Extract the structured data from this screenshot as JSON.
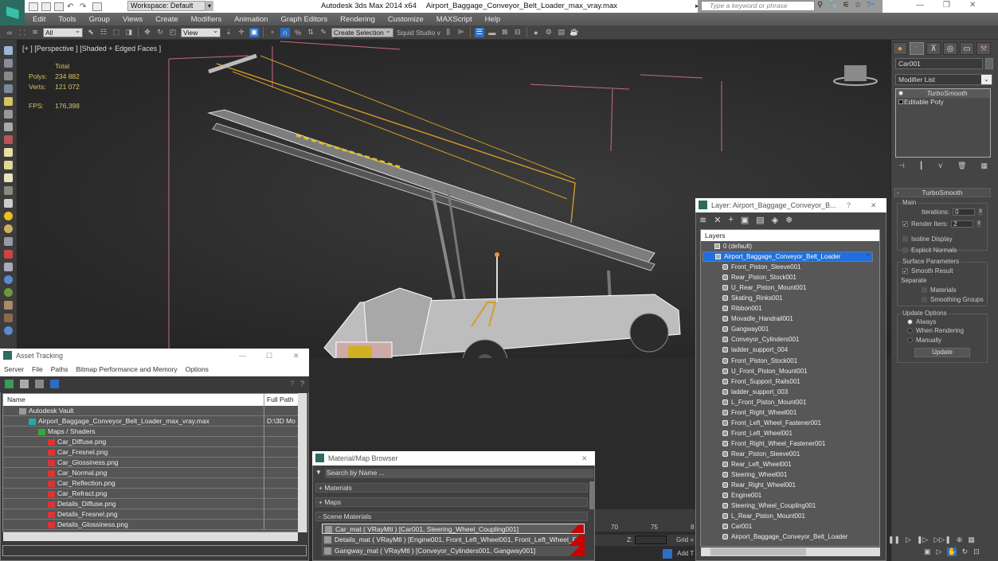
{
  "titlebar": {
    "workspace": "Workspace: Default",
    "app": "Autodesk 3ds Max  2014 x64",
    "file": "Airport_Baggage_Conveyor_Belt_Loader_max_vray.max",
    "search_placeholder": "Type a keyword or phrase"
  },
  "menu": [
    "Edit",
    "Tools",
    "Group",
    "Views",
    "Create",
    "Modifiers",
    "Animation",
    "Graph Editors",
    "Rendering",
    "Customize",
    "MAXScript",
    "Help"
  ],
  "toolbar": {
    "selection_filter": "All",
    "reference_coord": "View",
    "named_selection": "Create Selection Se",
    "squid_studio": "Squid Studio v"
  },
  "viewport": {
    "label": "[+ ] [Perspective ] [Shaded + Edged Faces ]",
    "stats": {
      "header": "Total",
      "polys_label": "Polys:",
      "polys": "234 882",
      "verts_label": "Verts:",
      "verts": "121 072",
      "fps_label": "FPS:",
      "fps": "176,398"
    }
  },
  "command_panel": {
    "object_name": "Car001",
    "modifier_list": "Modifier List",
    "stack": [
      "TurboSmooth",
      "Editable Poly"
    ],
    "rollout_title": "TurboSmooth",
    "main_group": "Main",
    "iterations_label": "Iterations:",
    "iterations": "0",
    "render_iters_label": "Render Iters:",
    "render_iters": "2",
    "render_iters_checked": true,
    "isoline_display": "Isoline Display",
    "explicit_normals": "Explicit Normals",
    "surface_group": "Surface Parameters",
    "smooth_result": "Smooth Result",
    "smooth_result_checked": true,
    "separate_label": "Separate",
    "materials": "Materials",
    "smoothing_groups": "Smoothing Groups",
    "update_group": "Update Options",
    "update_options": [
      "Always",
      "When Rendering",
      "Manually"
    ],
    "update_selected": "Always",
    "update_button": "Update"
  },
  "layer_dialog": {
    "title": "Layer: Airport_Baggage_Conveyor_B...",
    "help": "?",
    "close": "✕",
    "header": "Layers",
    "default_layer": "0 (default)",
    "selected_layer": "Airport_Baggage_Conveyor_Belt_Loader",
    "objects": [
      "Front_Piston_Sleeve001",
      "Rear_Piston_Stock001",
      "U_Rear_Piston_Mount001",
      "Skating_Rinks001",
      "Ribbon001",
      "Movadle_Handrail001",
      "Gangway001",
      "Conveyor_Cylinders001",
      "ladder_support_004",
      "Front_Piston_Stock001",
      "U_Front_Piston_Mount001",
      "Front_Support_Rails001",
      "ladder_support_003",
      "L_Front_Piston_Mount001",
      "Front_Right_Wheel001",
      "Front_Left_Wheel_Fastener001",
      "Front_Left_Wheel001",
      "Front_Right_Wheel_Fastener001",
      "Rear_Piston_Sleeve001",
      "Rear_Left_Wheel001",
      "Steering_Wheel001",
      "Rear_Right_Wheel001",
      "Engine001",
      "Steering_Wheel_Coupling001",
      "L_Rear_Piston_Mount001",
      "Car001",
      "Airport_Baggage_Conveyor_Belt_Loader"
    ]
  },
  "asset_tracking": {
    "title": "Asset Tracking",
    "menu": [
      "Server",
      "File",
      "Paths",
      "Bitmap Performance and Memory",
      "Options"
    ],
    "columns": [
      "Name",
      "Full Path"
    ],
    "rows": [
      {
        "name": "Autodesk Vault",
        "path": "",
        "level": 1
      },
      {
        "name": "Airport_Baggage_Conveyor_Belt_Loader_max_vray.max",
        "path": "D:\\3D Mo",
        "level": 2
      },
      {
        "name": "Maps / Shaders",
        "path": "",
        "level": 3
      },
      {
        "name": "Car_Diffuse.png",
        "path": "",
        "level": 4
      },
      {
        "name": "Car_Fresnel.png",
        "path": "",
        "level": 4
      },
      {
        "name": "Car_Glossiness.png",
        "path": "",
        "level": 4
      },
      {
        "name": "Car_Normal.png",
        "path": "",
        "level": 4
      },
      {
        "name": "Car_Reflection.png",
        "path": "",
        "level": 4
      },
      {
        "name": "Car_Refract.png",
        "path": "",
        "level": 4
      },
      {
        "name": "Details_Diffuse.png",
        "path": "",
        "level": 4
      },
      {
        "name": "Details_Fresnel.png",
        "path": "",
        "level": 4
      },
      {
        "name": "Details_Glossiness.png",
        "path": "",
        "level": 4
      }
    ]
  },
  "material_browser": {
    "title": "Material/Map Browser",
    "search_placeholder": "Search by Name ...",
    "groups": [
      "+ Materials",
      "+ Maps",
      "- Scene Materials"
    ],
    "items": [
      "Car_mat  ( VRayMtl ) [Car001, Steering_Wheel_Coupling001]",
      "Details_mat  ( VRayMtl ) [Engine001, Front_Left_Wheel001, Front_Left_Wheel_F...",
      "Gangway_mat  ( VRayMtl ) [Conveyor_Cylinders001, Gangway001]"
    ]
  },
  "status": {
    "timeline_ticks": [
      "70",
      "75",
      "8"
    ],
    "z_label": "Z:",
    "grid_label": "Grid =",
    "add_time_tag": "Add T"
  },
  "colors": {
    "accent": "#1f6fde",
    "stats": "#d6c462",
    "wire_orange": "#d49a2a",
    "grid_pink": "#c86a85"
  }
}
